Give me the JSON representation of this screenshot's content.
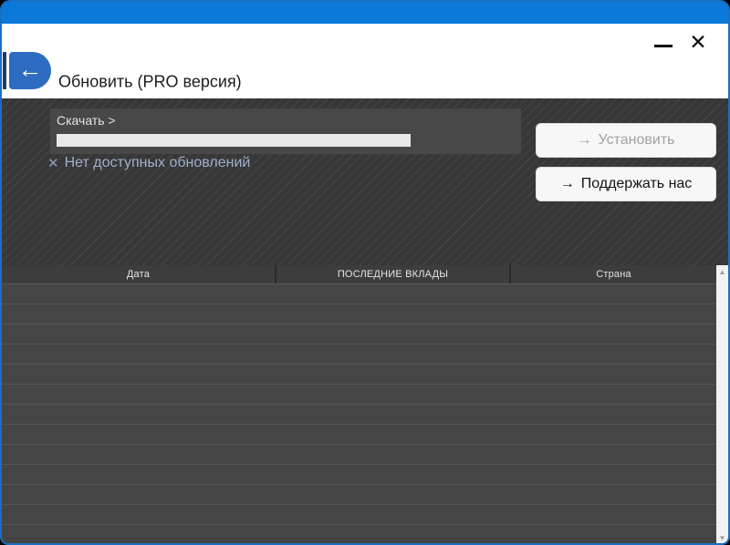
{
  "window": {
    "title": "Обновить (PRO версия)",
    "controls": {
      "close_icon": "✕"
    }
  },
  "header": {
    "back_icon": "←"
  },
  "update": {
    "download_label": "Скачать >",
    "status_icon": "✕",
    "status_text": "Нет доступных обновлений",
    "install_button": {
      "icon": "→",
      "label": "Установить",
      "enabled": false
    },
    "support_button": {
      "icon": "→",
      "label": "Поддержать нас",
      "enabled": true
    }
  },
  "table": {
    "columns": [
      "Дата",
      "ПОСЛЕДНИЕ ВКЛАДЫ",
      "Страна"
    ],
    "rows": [],
    "visible_empty_rows": 13,
    "scrollbar": {
      "up_icon": "▲",
      "down_icon": "▼"
    }
  },
  "colors": {
    "titlebar_blue": "#0a79d8",
    "window_border_blue": "#1b6ec2",
    "back_button_blue": "#2d6cc0",
    "back_accent_navy": "#1c3a69",
    "section_bg": "#373737",
    "panel_bg": "#484848",
    "progress_bar": "#e9e9e9",
    "status_text": "#9db0cc",
    "table_header_bg": "#3d3d3d",
    "row_bg": "#454545",
    "row_separator": "#575757",
    "scrollbar_track": "#f2f2f2"
  }
}
